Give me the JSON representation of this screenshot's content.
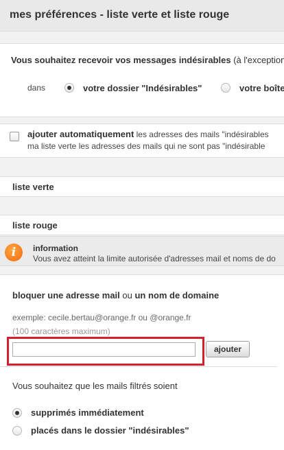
{
  "header": {
    "title": "mes préférences - liste verte et liste rouge"
  },
  "delivery": {
    "question_bold": "Vous souhaitez recevoir vos messages indésirables",
    "question_rest": " (à l'exception",
    "dans_label": "dans",
    "option_junk": "votre dossier \"Indésirables\"",
    "option_inbox": "votre boîte"
  },
  "auto_add": {
    "label_bold": "ajouter automatiquement",
    "label_rest": " les adresses des mails \"indésirables",
    "line2": "ma liste verte les adresses des mails qui ne sont pas \"indésirable"
  },
  "lists": {
    "green": "liste verte",
    "red": "liste rouge"
  },
  "info": {
    "icon_glyph": "i",
    "title": "information",
    "message": "Vous avez atteint la limite autorisée d'adresses mail et noms de do"
  },
  "block": {
    "heading_part1": "bloquer une adresse mail",
    "heading_part2": " ou ",
    "heading_part3": "un nom de domaine",
    "example": "exemple: cecile.bertau@orange.fr ou @orange.fr",
    "max_chars": "(100 caractères maximum)",
    "input_value": "",
    "add_button": "ajouter",
    "filter_question": "Vous souhaitez que les mails filtrés soient",
    "option_delete": "supprimés immédiatement",
    "option_folder": "placés dans le dossier \"indésirables\""
  }
}
